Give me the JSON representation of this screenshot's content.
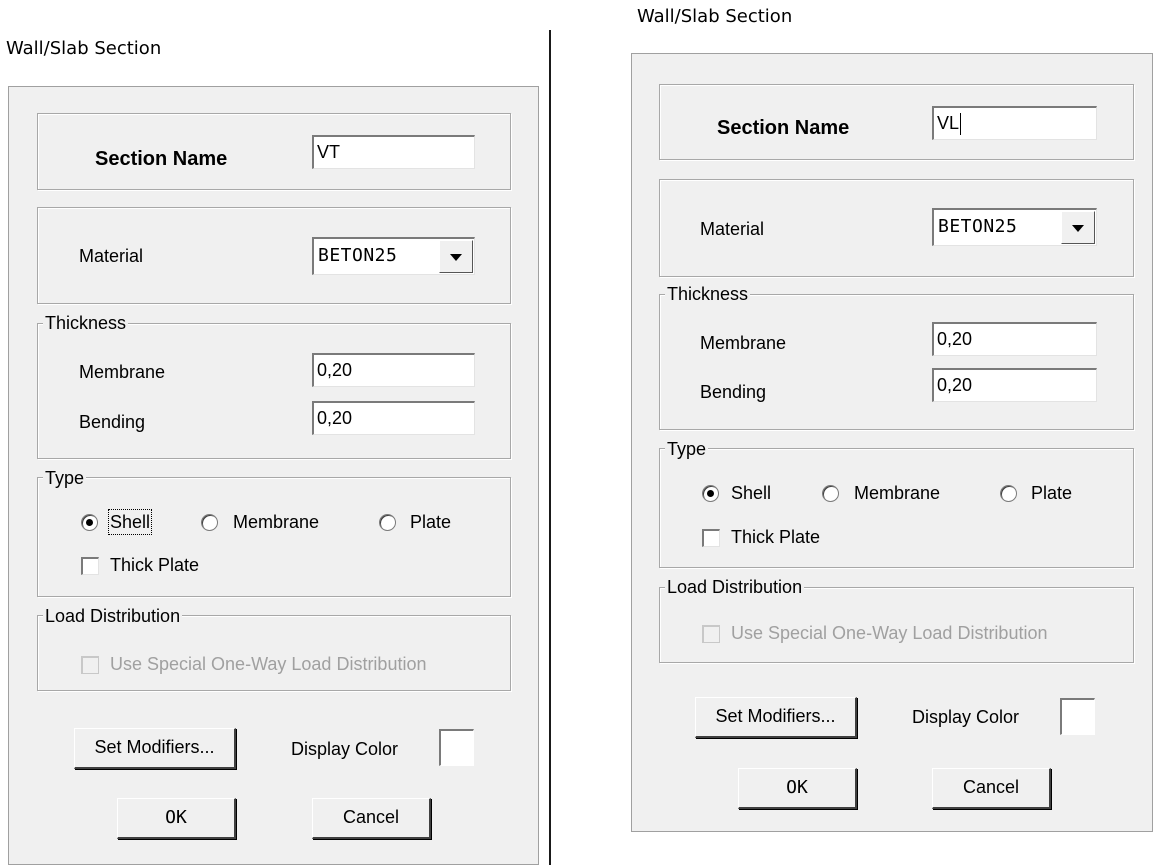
{
  "left": {
    "title": "Wall/Slab Section",
    "section_name_label": "Section Name",
    "section_name_value": "VT",
    "material_label": "Material",
    "material_value": "BETON25",
    "thickness_legend": "Thickness",
    "membrane_label": "Membrane",
    "membrane_value": "0,20",
    "bending_label": "Bending",
    "bending_value": "0,20",
    "type_legend": "Type",
    "shell_label": "Shell",
    "membrane_radio_label": "Membrane",
    "plate_label": "Plate",
    "thick_plate_label": "Thick Plate",
    "load_dist_legend": "Load Distribution",
    "one_way_label": "Use Special One-Way Load Distribution",
    "set_modifiers_label": "Set Modifiers...",
    "display_color_label": "Display Color",
    "ok_label": "OK",
    "cancel_label": "Cancel",
    "selected_type": "Shell"
  },
  "right": {
    "title": "Wall/Slab Section",
    "section_name_label": "Section Name",
    "section_name_value": "VL",
    "material_label": "Material",
    "material_value": "BETON25",
    "thickness_legend": "Thickness",
    "membrane_label": "Membrane",
    "membrane_value": "0,20",
    "bending_label": "Bending",
    "bending_value": "0,20",
    "type_legend": "Type",
    "shell_label": "Shell",
    "membrane_radio_label": "Membrane",
    "plate_label": "Plate",
    "thick_plate_label": "Thick Plate",
    "load_dist_legend": "Load Distribution",
    "one_way_label": "Use Special One-Way Load Distribution",
    "set_modifiers_label": "Set Modifiers...",
    "display_color_label": "Display Color",
    "ok_label": "OK",
    "cancel_label": "Cancel",
    "selected_type": "Shell"
  },
  "icons": {
    "dropdown": "chevron-down-icon",
    "radio": "radio-icon",
    "checkbox": "checkbox-icon"
  },
  "colors": {
    "dialog_bg": "#f0f0f0",
    "page_bg": "#ffffff",
    "disabled_text": "#a0a0a0"
  }
}
